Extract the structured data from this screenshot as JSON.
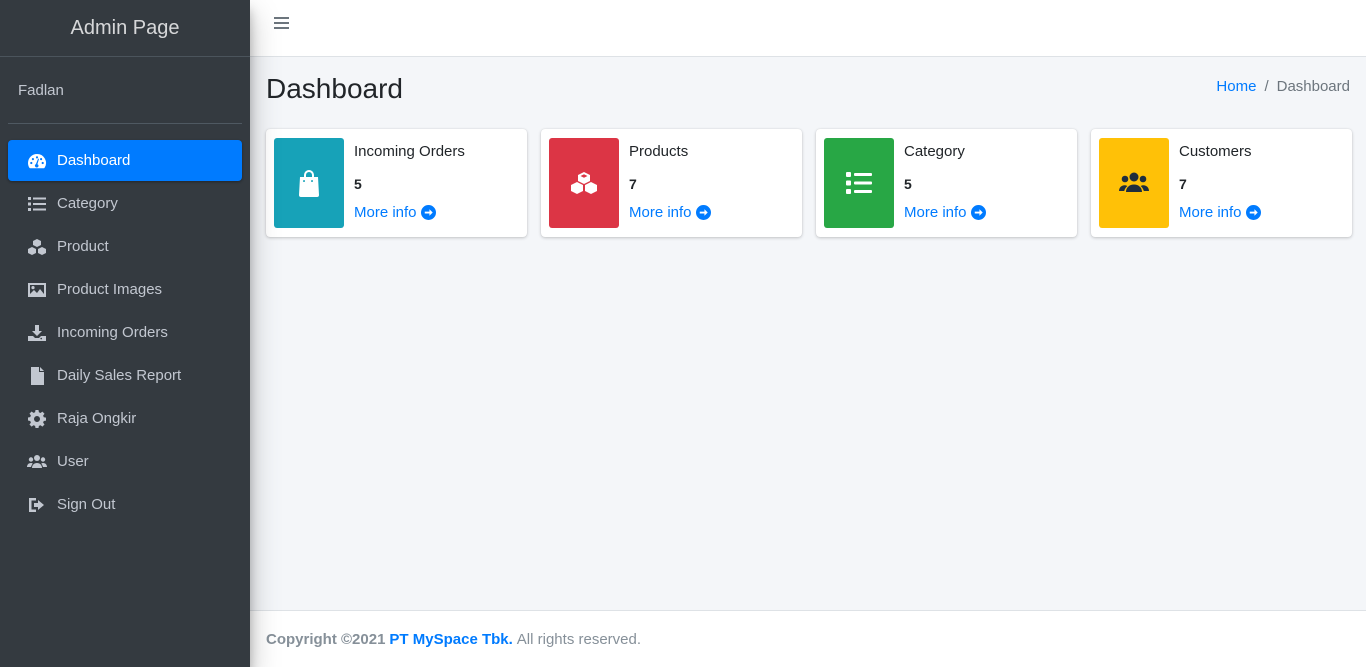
{
  "brand": "Admin Page",
  "user_name": "Fadlan",
  "nav": [
    {
      "label": "Dashboard",
      "icon": "tachometer-icon",
      "active": true
    },
    {
      "label": "Category",
      "icon": "list-icon"
    },
    {
      "label": "Product",
      "icon": "cubes-icon"
    },
    {
      "label": "Product Images",
      "icon": "image-icon"
    },
    {
      "label": "Incoming Orders",
      "icon": "download-icon"
    },
    {
      "label": "Daily Sales Report",
      "icon": "file-icon"
    },
    {
      "label": "Raja Ongkir",
      "icon": "gear-icon"
    },
    {
      "label": "User",
      "icon": "users-icon"
    },
    {
      "label": "Sign Out",
      "icon": "sign-out-icon"
    }
  ],
  "page": {
    "title": "Dashboard",
    "breadcrumb": {
      "home": "Home",
      "separator": "/",
      "current": "Dashboard"
    }
  },
  "info_boxes": [
    {
      "title": "Incoming Orders",
      "value": "5",
      "link": "More info",
      "color": "#17a2b8",
      "icon": "shopping-bag-icon"
    },
    {
      "title": "Products",
      "value": "7",
      "link": "More info",
      "color": "#dc3545",
      "icon": "cubes-icon"
    },
    {
      "title": "Category",
      "value": "5",
      "link": "More info",
      "color": "#28a745",
      "icon": "list-icon"
    },
    {
      "title": "Customers",
      "value": "7",
      "link": "More info",
      "color": "#ffc107",
      "icon": "users-icon"
    }
  ],
  "footer": {
    "copyright": "Copyright ©2021",
    "company": "PT MySpace Tbk.",
    "rights": "All rights reserved."
  },
  "colors": {
    "sidebar_bg": "#343a40",
    "accent": "#007bff",
    "content_bg": "#f4f6f9"
  }
}
